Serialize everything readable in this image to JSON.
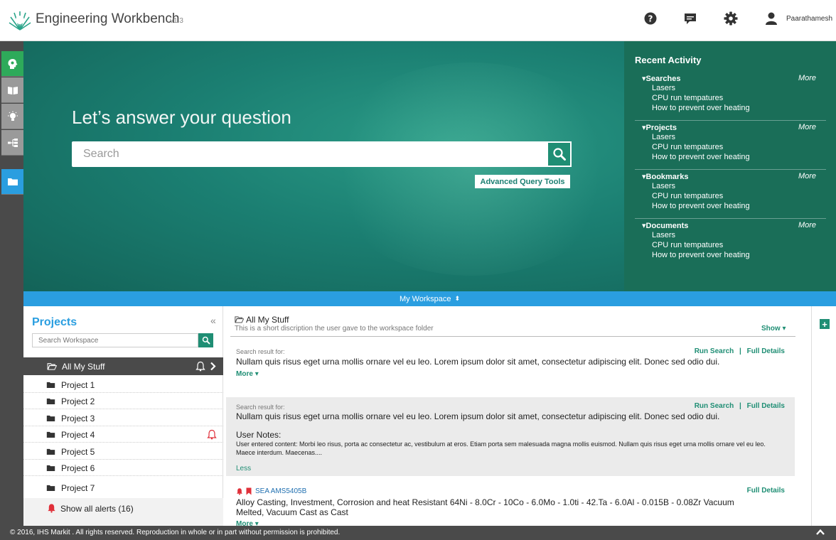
{
  "app": {
    "title": "Engineering Workbench",
    "version": "v1.3",
    "username": "Paarathamesh",
    "header_icons": [
      "help-icon",
      "chat-icon",
      "gear-icon",
      "user-icon"
    ]
  },
  "rail": {
    "icons": [
      "brain-icon",
      "book-icon",
      "lightbulb-icon",
      "hierarchy-icon",
      "folder-icon"
    ]
  },
  "hero": {
    "title": "Let’s answer your question",
    "search_placeholder": "Search",
    "advanced_button": "Advanced Query Tools"
  },
  "recent": {
    "title": "Recent Activity",
    "more_label": "More",
    "sections": [
      {
        "name": "Searches",
        "items": [
          "Lasers",
          "CPU run tempatures",
          "How to prevent over heating"
        ]
      },
      {
        "name": "Projects",
        "items": [
          "Lasers",
          "CPU run tempatures",
          "How to prevent over heating"
        ]
      },
      {
        "name": "Bookmarks",
        "items": [
          "Lasers",
          "CPU run tempatures",
          "How to prevent over heating"
        ]
      },
      {
        "name": "Documents",
        "items": [
          "Lasers",
          "CPU run tempatures",
          "How to prevent over heating"
        ]
      }
    ]
  },
  "workspace_bar": {
    "label": "My Workspace"
  },
  "projects": {
    "title": "Projects",
    "search_placeholder": "Search Workspace",
    "all_stuff": "All My Stuff",
    "items": [
      "Project 1",
      "Project 2",
      "Project 3",
      "Project 4",
      "Project 5",
      "Project 6",
      "Project 7"
    ],
    "alerts": "Show all alerts (16)"
  },
  "main": {
    "folder_title": "All My Stuff",
    "folder_desc": "This is a short discription the user gave to the workspace folder",
    "show": "Show",
    "result_label": "Search result for:",
    "run_search": "Run Search",
    "separator": "|",
    "full_details": "Full Details",
    "result_text": "Nullam quis risus eget urna mollis ornare vel eu leo. Lorem ipsum dolor sit amet, consectetur adipiscing elit. Donec sed odio dui.",
    "more": "More",
    "notes_heading": "User Notes:",
    "notes_text": "User entered content: Morbi leo risus, porta ac consectetur ac, vestibulum at eros. Etiam porta sem malesuada magna mollis euismod. Nullam quis risus eget urna mollis ornare vel eu leo. Maece interdum. Maecenas....",
    "less": "Less",
    "doc_id": "SEA AMS5405B",
    "doc_text": "Alloy Casting, Investment, Corrosion and heat Resistant 64Ni - 8.0Cr - 10Co - 6.0Mo - 1.0ti - 42.Ta - 6.0Al - 0.015B - 0.08Zr Vacuum Melted, Vacuum Cast as Cast"
  },
  "footer": {
    "copyright": "© 2016, IHS Markit   . All rights reserved. Reproduction in whole or in part without permission is prohibited."
  },
  "colors": {
    "accent_green": "#1f8e74",
    "accent_blue": "#2a9ee0",
    "dark_grey": "#4a4a4a"
  }
}
